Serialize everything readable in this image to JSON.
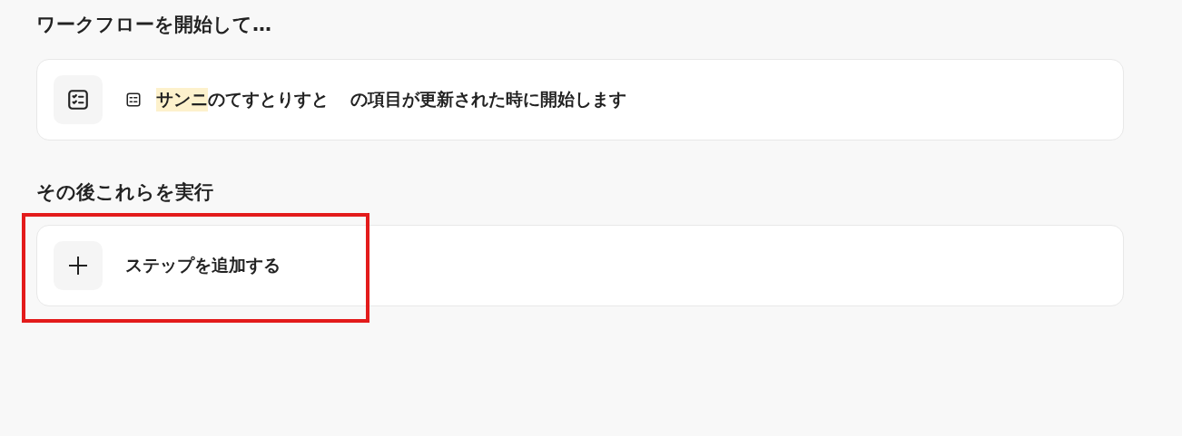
{
  "trigger_section": {
    "heading": "ワークフローを開始して…",
    "card": {
      "source_tag": "サンニ",
      "source_name": "のてすとりすと",
      "description": "の項目が更新された時に開始します"
    }
  },
  "action_section": {
    "heading": "その後これらを実行",
    "add_step": {
      "label": "ステップを追加する",
      "highlighted": true
    }
  }
}
